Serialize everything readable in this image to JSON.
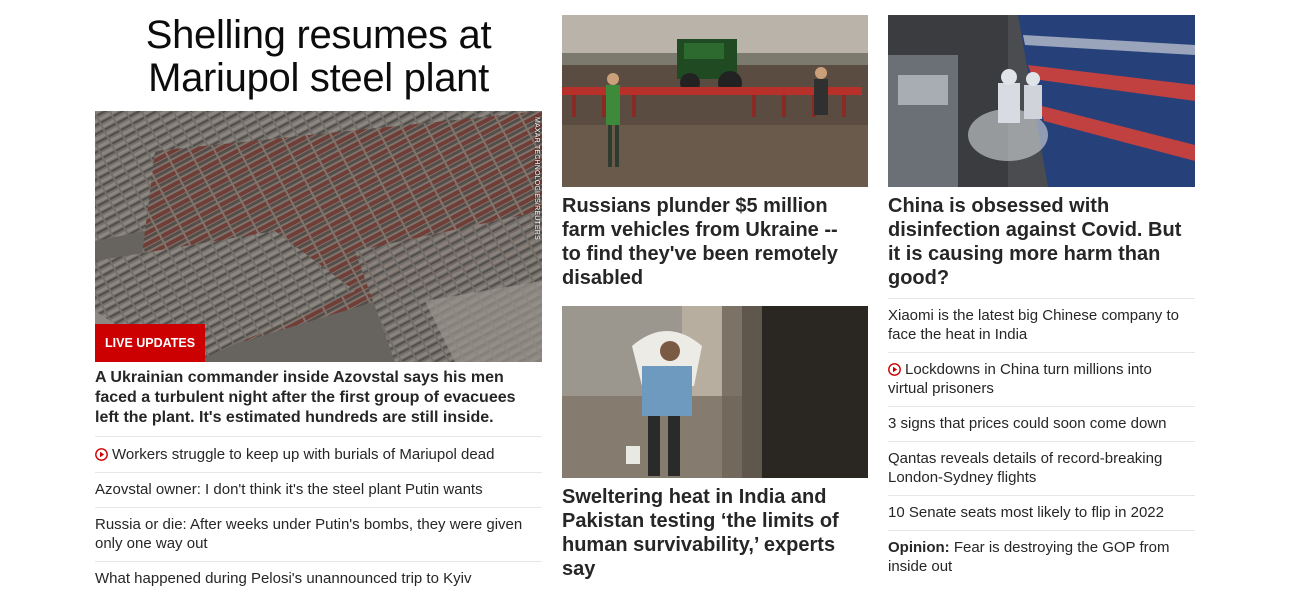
{
  "main": {
    "headline": "Shelling resumes at Mariupol steel plant",
    "hero_credit": "MAXAR TECHNOLOGIES/REUTERS",
    "live_badge": "LIVE UPDATES",
    "hero_description": "A Ukrainian commander inside Azovstal says his men faced a turbulent night after the first group of evacuees left the plant. It's estimated hundreds are still inside.",
    "related": [
      {
        "label": "Workers struggle to keep up with burials of Mariupol dead",
        "video": true
      },
      {
        "label": "Azovstal owner: I don't think it's the steel plant Putin wants",
        "video": false
      },
      {
        "label": "Russia or die: After weeks under Putin's bombs, they were given only one way out",
        "video": false
      },
      {
        "label": "What happened during Pelosi's unannounced trip to Kyiv",
        "video": false
      }
    ]
  },
  "middle": {
    "story1_title": "Russians plunder $5 million farm vehicles from Ukraine -- to find they've been remotely disabled",
    "story2_title": "Sweltering heat in India and Pakistan testing ‘the limits of human survivability,’ experts say"
  },
  "right": {
    "story_title": "China is obsessed with disinfection against Covid. But it is causing more harm than good?",
    "items": [
      {
        "label": "Xiaomi is the latest big Chinese company to face the heat in India"
      },
      {
        "label": "Lockdowns in China turn millions into virtual prisoners"
      },
      {
        "label": "3 signs that prices could soon come down"
      },
      {
        "label": "Qantas reveals details of record-breaking London-Sydney flights"
      },
      {
        "label": "10 Senate seats most likely to flip in 2022"
      }
    ],
    "opinion_prefix": "Opinion:",
    "opinion_text": " Fear is destroying the GOP from inside out"
  },
  "colors": {
    "accent_red": "#cc0000",
    "text": "#262626",
    "divider": "#e6e6e6"
  },
  "icons": {
    "video": "play-circle-icon"
  }
}
